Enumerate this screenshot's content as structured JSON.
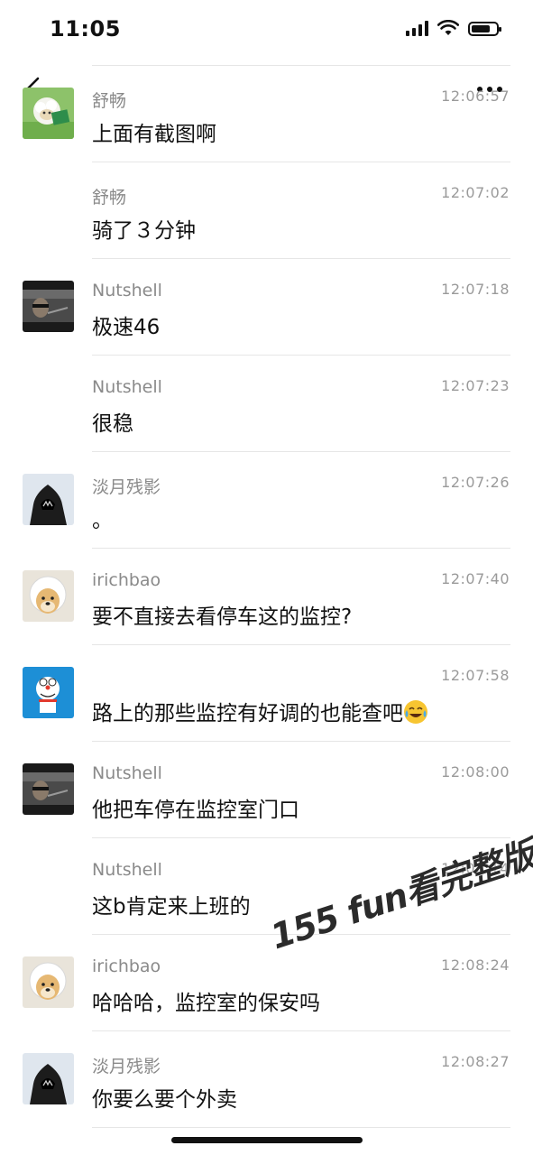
{
  "status_bar": {
    "time": "11:05"
  },
  "watermark": "155 fun看完整版",
  "messages": [
    {
      "name": "舒畅",
      "time": "12:06:57",
      "text": "上面有截图啊",
      "avatar": "sheep-avatar"
    },
    {
      "name": "舒畅",
      "time": "12:07:02",
      "text": "骑了３分钟",
      "avatar": ""
    },
    {
      "name": "Nutshell",
      "time": "12:07:18",
      "text": "极速46",
      "avatar": "car-driver-avatar"
    },
    {
      "name": "Nutshell",
      "time": "12:07:23",
      "text": "很稳",
      "avatar": ""
    },
    {
      "name": "淡月残影",
      "time": "12:07:26",
      "text": "。",
      "avatar": "hooded-figure-avatar"
    },
    {
      "name": "irichbao",
      "time": "12:07:40",
      "text": "要不直接去看停车这的监控?",
      "avatar": "doge-avatar"
    },
    {
      "name": "",
      "time": "12:07:58",
      "text": "路上的那些监控有好调的也能查吧",
      "avatar": "doraemon-avatar",
      "emoji": "laughing-crying-emoji"
    },
    {
      "name": "Nutshell",
      "time": "12:08:00",
      "text": "他把车停在监控室门口",
      "avatar": "car-driver-avatar"
    },
    {
      "name": "Nutshell",
      "time": "12:08:14",
      "text": "这b肯定来上班的",
      "avatar": ""
    },
    {
      "name": "irichbao",
      "time": "12:08:24",
      "text": "哈哈哈，监控室的保安吗",
      "avatar": "doge-avatar"
    },
    {
      "name": "淡月残影",
      "time": "12:08:27",
      "text": "你要么要个外卖",
      "avatar": "hooded-figure-avatar"
    }
  ]
}
